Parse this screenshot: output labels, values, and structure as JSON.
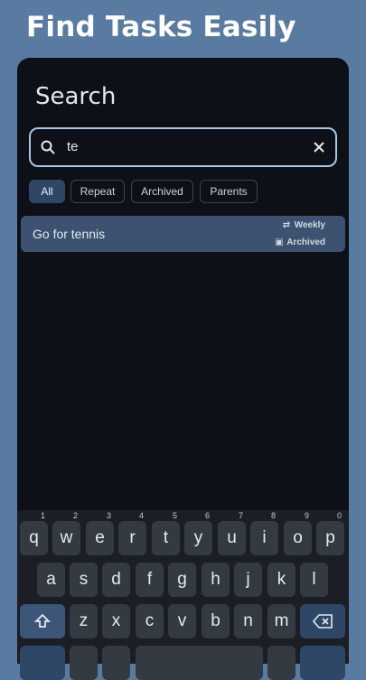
{
  "headline": "Find Tasks Easily",
  "screen": {
    "title": "Search",
    "search_value": "te",
    "filters": [
      "All",
      "Repeat",
      "Archived",
      "Parents"
    ],
    "active_filter": "All"
  },
  "task": {
    "title": "Go for tennis",
    "repeat_label": "Weekly",
    "status_label": "Archived"
  },
  "keyboard": {
    "row1": [
      "q",
      "w",
      "e",
      "r",
      "t",
      "y",
      "u",
      "i",
      "o",
      "p"
    ],
    "row1_hints": [
      "1",
      "2",
      "3",
      "4",
      "5",
      "6",
      "7",
      "8",
      "9",
      "0"
    ],
    "row2": [
      "a",
      "s",
      "d",
      "f",
      "g",
      "h",
      "j",
      "k",
      "l"
    ],
    "row3": [
      "z",
      "x",
      "c",
      "v",
      "b",
      "n",
      "m"
    ]
  },
  "colors": {
    "background": "#5a7ba1",
    "panel": "#0d1117",
    "accent": "#a9c6e6"
  }
}
